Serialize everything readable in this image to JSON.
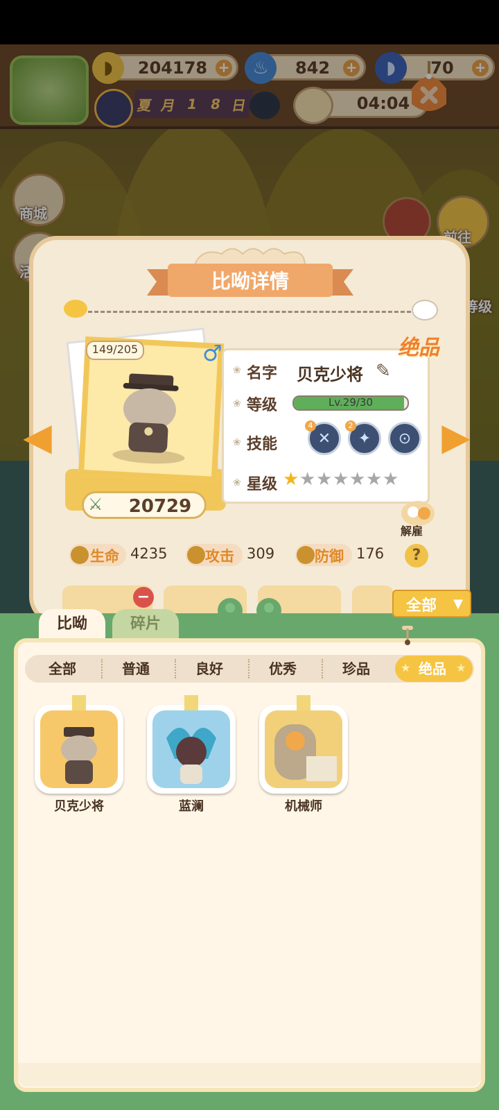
{
  "resources": {
    "banana": "204178",
    "flame": "842",
    "blue_banana": "70"
  },
  "date_chars": [
    "夏",
    "月",
    "1",
    "8",
    "日"
  ],
  "timer": "04:04",
  "side_menu": {
    "shop": "商城",
    "activity": "活",
    "goto": "前往",
    "level": "等级"
  },
  "details": {
    "title": "比呦详情",
    "level_counter": "149/205",
    "gender": "♂",
    "rarity_stamp": "绝品",
    "power": "20729",
    "labels": {
      "name": "名字",
      "level": "等级",
      "skill": "技能",
      "star": "星级"
    },
    "name": "贝克少将",
    "level_text": "Lv.29/30",
    "level_progress": 0.967,
    "skills": [
      {
        "icon": "wrench-icon",
        "badge": "4"
      },
      {
        "icon": "compass-icon",
        "badge": "2"
      },
      {
        "icon": "lock-icon",
        "badge": ""
      }
    ],
    "stars_filled": 1,
    "stars_total": 7,
    "dismiss": "解雇",
    "stats": [
      {
        "label": "生命",
        "value": "4235"
      },
      {
        "label": "攻击",
        "value": "309"
      },
      {
        "label": "防御",
        "value": "176"
      }
    ],
    "help": "?"
  },
  "filter_dropdown": "全部",
  "tabs": {
    "biyou": "比呦",
    "fragments": "碎片"
  },
  "rarity_tabs": [
    "全部",
    "普通",
    "良好",
    "优秀",
    "珍品",
    "绝品"
  ],
  "rarity_active_index": 5,
  "characters": [
    {
      "name": "贝克少将",
      "color": "#f7c86a"
    },
    {
      "name": "蓝澜",
      "color": "#9ed2ea"
    },
    {
      "name": "机械师",
      "color": "#f2d07a"
    }
  ],
  "colors": {
    "accent_orange": "#f0a030",
    "panel_green": "#69a86c",
    "gold": "#f6c443"
  }
}
